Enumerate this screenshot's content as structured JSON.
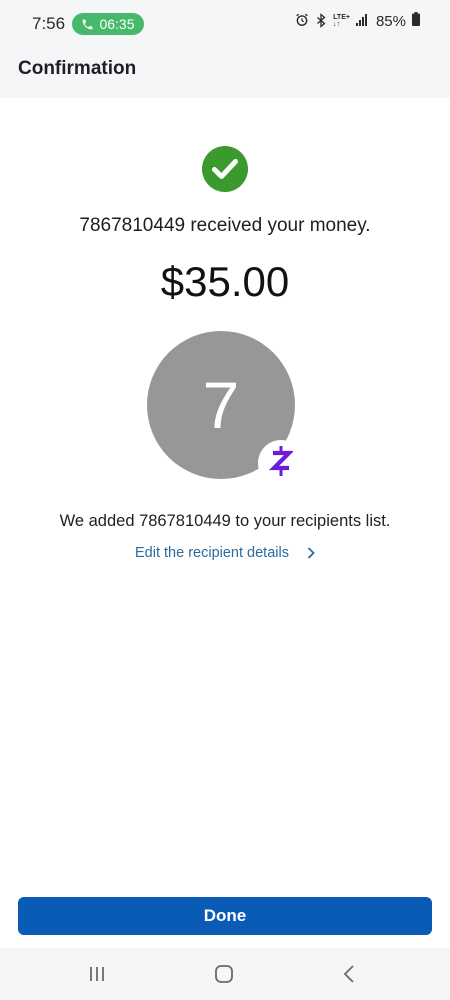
{
  "status_bar": {
    "time": "7:56",
    "call_timer": "06:35",
    "network": [
      "LTE+",
      "↓↑"
    ],
    "battery": "85%",
    "icons": [
      "phone-icon",
      "alarm-icon",
      "bluetooth-icon",
      "signal-icon",
      "battery-icon"
    ]
  },
  "header": {
    "title": "Confirmation"
  },
  "confirmation": {
    "status_icon": "check-circle-icon",
    "message": "7867810449 received your money.",
    "amount": "$35.00",
    "avatar_initial": "7",
    "badge_icon": "zelle-icon",
    "recipient_note": "We added 7867810449 to your recipients list.",
    "edit_link": "Edit the recipient details"
  },
  "actions": {
    "done_label": "Done"
  },
  "navigation": {
    "items": [
      "recent-apps-icon",
      "home-icon",
      "back-icon"
    ]
  },
  "colors": {
    "accent": "#0a5bb5",
    "success": "#3a9a2e",
    "zelle": "#6d1ed4",
    "link": "#2c6a9d",
    "call_pill": "#47b96b"
  }
}
